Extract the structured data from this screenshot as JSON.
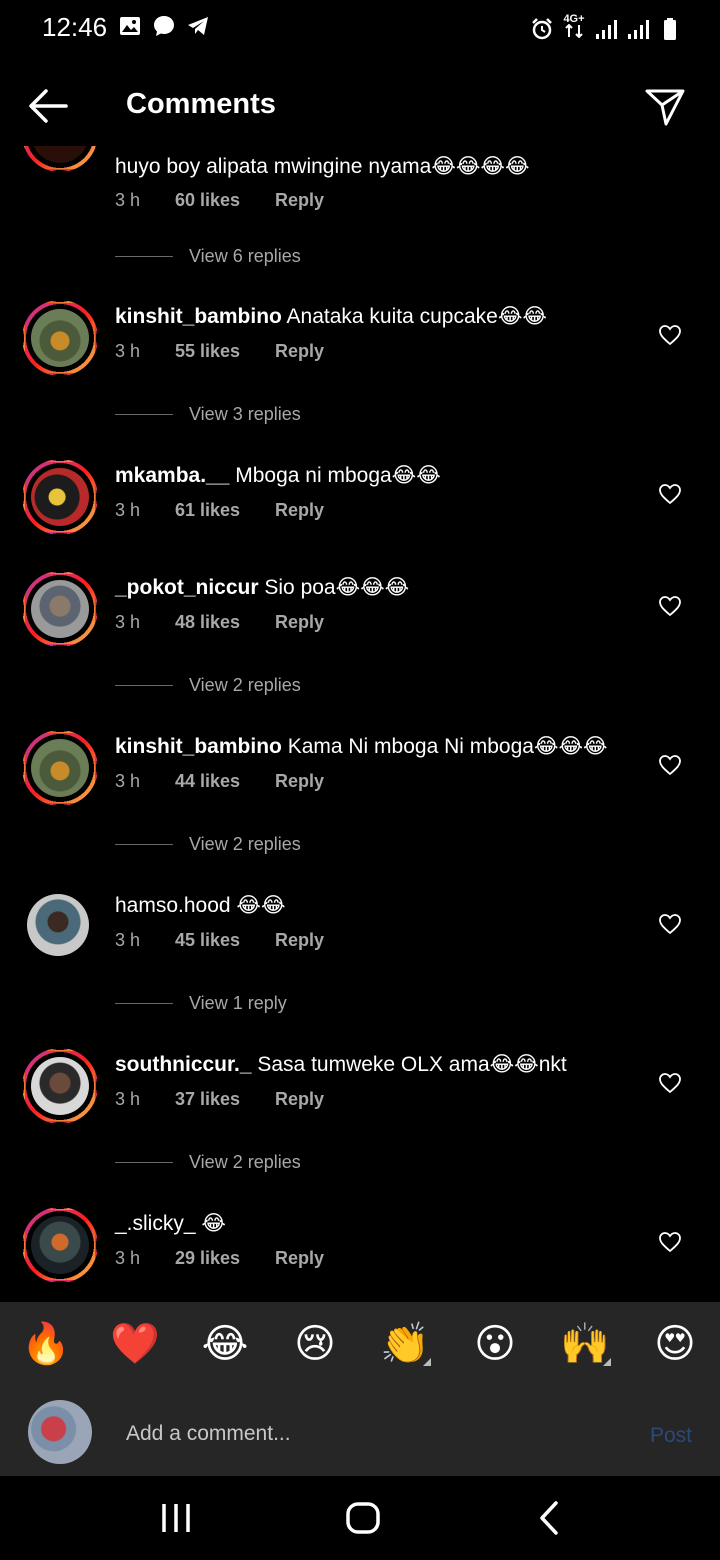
{
  "status_bar": {
    "time": "12:46",
    "left_icons": [
      "image-icon",
      "chat-bubble-icon",
      "telegram-icon"
    ],
    "network_label": "4G+",
    "right_icons": [
      "alarm-icon",
      "network-icon",
      "signal-icon",
      "signal-icon",
      "battery-icon"
    ]
  },
  "header": {
    "title": "Comments",
    "back_icon": "arrow-left-icon",
    "share_icon": "send-icon"
  },
  "comments": [
    {
      "username": "",
      "text": "huyo boy alipata mwingine nyama😂😂😂😂",
      "time": "3 h",
      "likes": "60 likes",
      "reply": "Reply",
      "view_replies": "View 6 replies"
    },
    {
      "username": "kinshit_bambino",
      "text": " Anataka kuita  cupcake😂😂",
      "time": "3 h",
      "likes": "55 likes",
      "reply": "Reply",
      "view_replies": "View 3 replies"
    },
    {
      "username": "mkamba.__",
      "text": " Mboga ni mboga😂😂",
      "time": "3 h",
      "likes": "61 likes",
      "reply": "Reply",
      "view_replies": ""
    },
    {
      "username": "_pokot_niccur",
      "text": " Sio poa😂😂😂",
      "time": "3 h",
      "likes": "48 likes",
      "reply": "Reply",
      "view_replies": "View 2 replies"
    },
    {
      "username": "kinshit_bambino",
      "text": " Kama Ni mboga Ni mboga😂😂😂",
      "time": "3 h",
      "likes": "44 likes",
      "reply": "Reply",
      "view_replies": "View 2 replies"
    },
    {
      "username": "hamso.hood",
      "text": " 😂😂",
      "time": "3 h",
      "likes": "45 likes",
      "reply": "Reply",
      "view_replies": "View 1 reply"
    },
    {
      "username": "southniccur._",
      "text": " Sasa tumweke OLX ama😂😂nkt",
      "time": "3 h",
      "likes": "37 likes",
      "reply": "Reply",
      "view_replies": "View 2 replies"
    },
    {
      "username": "_.slicky_",
      "text": " 😂",
      "time": "3 h",
      "likes": "29 likes",
      "reply": "Reply",
      "view_replies": ""
    }
  ],
  "reactions": [
    "🔥",
    "❤️",
    "😂",
    "😢",
    "👏",
    "😮",
    "🙌",
    "😍"
  ],
  "comment_input": {
    "placeholder": "Add a comment...",
    "post_label": "Post"
  },
  "nav_bar": {
    "icons": [
      "recent-apps-icon",
      "home-icon",
      "back-icon"
    ]
  },
  "colors": {
    "background": "#000000",
    "secondary_text": "#a8a8a8",
    "panel": "#262626",
    "post_disabled": "#2a4a7a"
  }
}
